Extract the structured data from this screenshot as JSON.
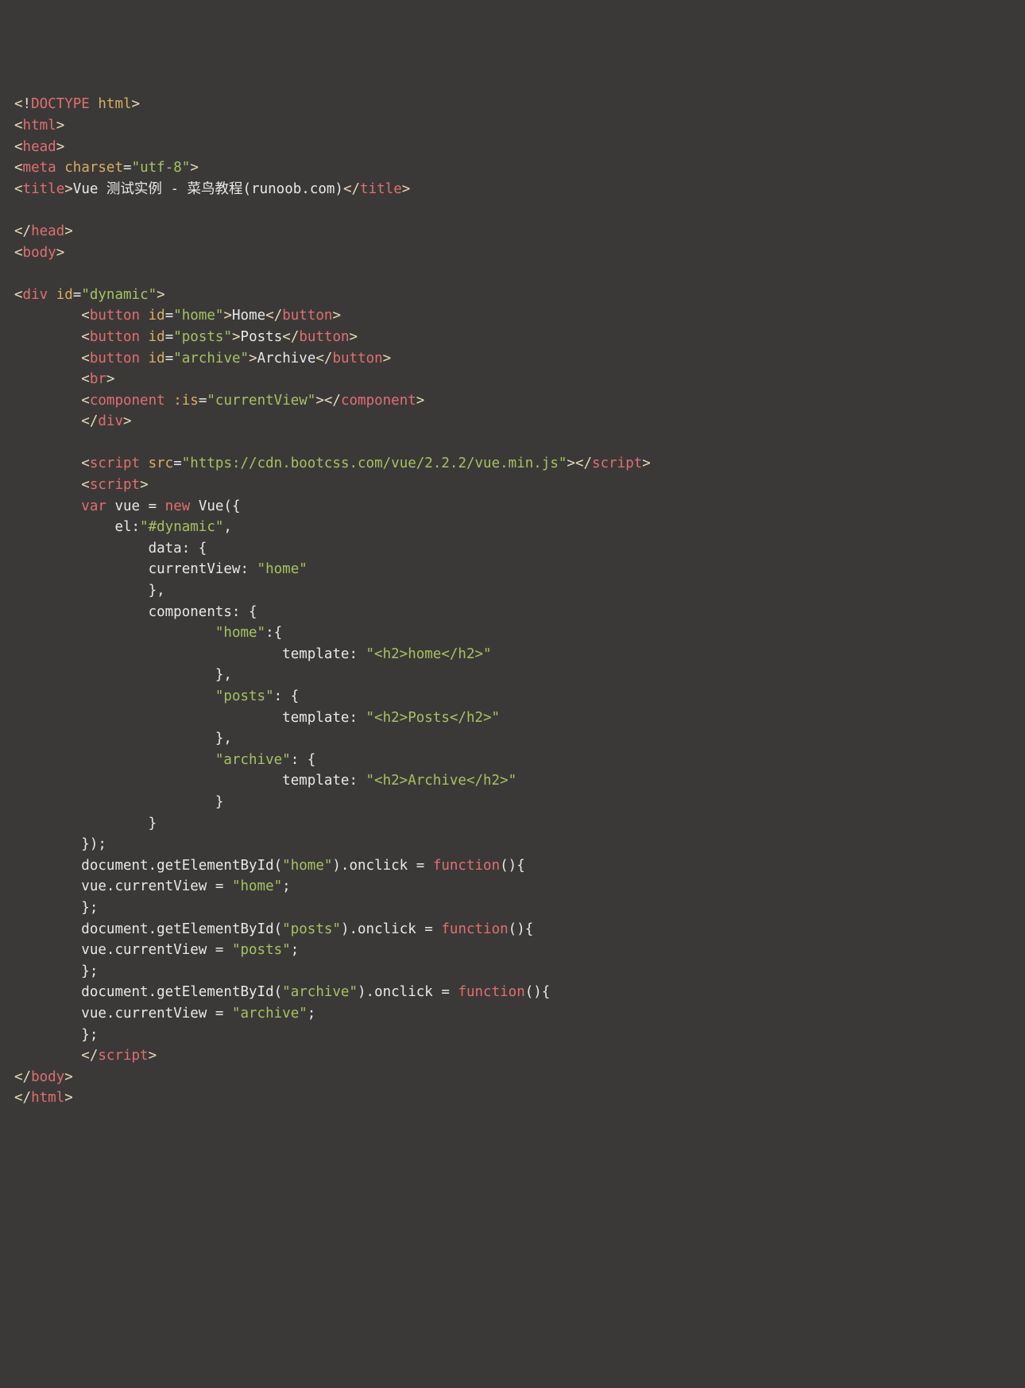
{
  "lines": [
    {
      "indent": 0,
      "parts": [
        {
          "c": "tag-bracket",
          "t": "<!"
        },
        {
          "c": "tag-name",
          "t": "DOCTYPE"
        },
        {
          "c": "text",
          "t": " "
        },
        {
          "c": "attr-name",
          "t": "html"
        },
        {
          "c": "tag-bracket",
          "t": ">"
        }
      ]
    },
    {
      "indent": 0,
      "parts": [
        {
          "c": "tag-bracket",
          "t": "<"
        },
        {
          "c": "tag-name",
          "t": "html"
        },
        {
          "c": "tag-bracket",
          "t": ">"
        }
      ]
    },
    {
      "indent": 0,
      "parts": [
        {
          "c": "tag-bracket",
          "t": "<"
        },
        {
          "c": "tag-name",
          "t": "head"
        },
        {
          "c": "tag-bracket",
          "t": ">"
        }
      ]
    },
    {
      "indent": 0,
      "parts": [
        {
          "c": "tag-bracket",
          "t": "<"
        },
        {
          "c": "tag-name",
          "t": "meta"
        },
        {
          "c": "text",
          "t": " "
        },
        {
          "c": "attr-name",
          "t": "charset"
        },
        {
          "c": "attr-eq",
          "t": "="
        },
        {
          "c": "attr-val",
          "t": "\"utf-8\""
        },
        {
          "c": "tag-bracket",
          "t": ">"
        }
      ]
    },
    {
      "indent": 0,
      "parts": [
        {
          "c": "tag-bracket",
          "t": "<"
        },
        {
          "c": "tag-name",
          "t": "title"
        },
        {
          "c": "tag-bracket",
          "t": ">"
        },
        {
          "c": "text",
          "t": "Vue 测试实例 - 菜鸟教程(runoob.com)"
        },
        {
          "c": "tag-bracket",
          "t": "</"
        },
        {
          "c": "tag-name",
          "t": "title"
        },
        {
          "c": "tag-bracket",
          "t": ">"
        }
      ]
    },
    {
      "indent": 0,
      "parts": [
        {
          "c": "text",
          "t": " "
        }
      ]
    },
    {
      "indent": 0,
      "parts": [
        {
          "c": "tag-bracket",
          "t": "</"
        },
        {
          "c": "tag-name",
          "t": "head"
        },
        {
          "c": "tag-bracket",
          "t": ">"
        }
      ]
    },
    {
      "indent": 0,
      "parts": [
        {
          "c": "tag-bracket",
          "t": "<"
        },
        {
          "c": "tag-name",
          "t": "body"
        },
        {
          "c": "tag-bracket",
          "t": ">"
        }
      ]
    },
    {
      "indent": 0,
      "parts": [
        {
          "c": "text",
          "t": " "
        }
      ]
    },
    {
      "indent": 0,
      "parts": [
        {
          "c": "tag-bracket",
          "t": "<"
        },
        {
          "c": "tag-name",
          "t": "div"
        },
        {
          "c": "text",
          "t": " "
        },
        {
          "c": "attr-name",
          "t": "id"
        },
        {
          "c": "attr-eq",
          "t": "="
        },
        {
          "c": "attr-val",
          "t": "\"dynamic\""
        },
        {
          "c": "tag-bracket",
          "t": ">"
        }
      ]
    },
    {
      "indent": 8,
      "parts": [
        {
          "c": "tag-bracket",
          "t": "<"
        },
        {
          "c": "tag-name",
          "t": "button"
        },
        {
          "c": "text",
          "t": " "
        },
        {
          "c": "attr-name",
          "t": "id"
        },
        {
          "c": "attr-eq",
          "t": "="
        },
        {
          "c": "attr-val",
          "t": "\"home\""
        },
        {
          "c": "tag-bracket",
          "t": ">"
        },
        {
          "c": "text",
          "t": "Home"
        },
        {
          "c": "tag-bracket",
          "t": "</"
        },
        {
          "c": "tag-name",
          "t": "button"
        },
        {
          "c": "tag-bracket",
          "t": ">"
        }
      ]
    },
    {
      "indent": 8,
      "parts": [
        {
          "c": "tag-bracket",
          "t": "<"
        },
        {
          "c": "tag-name",
          "t": "button"
        },
        {
          "c": "text",
          "t": " "
        },
        {
          "c": "attr-name",
          "t": "id"
        },
        {
          "c": "attr-eq",
          "t": "="
        },
        {
          "c": "attr-val",
          "t": "\"posts\""
        },
        {
          "c": "tag-bracket",
          "t": ">"
        },
        {
          "c": "text",
          "t": "Posts"
        },
        {
          "c": "tag-bracket",
          "t": "</"
        },
        {
          "c": "tag-name",
          "t": "button"
        },
        {
          "c": "tag-bracket",
          "t": ">"
        }
      ]
    },
    {
      "indent": 8,
      "parts": [
        {
          "c": "tag-bracket",
          "t": "<"
        },
        {
          "c": "tag-name",
          "t": "button"
        },
        {
          "c": "text",
          "t": " "
        },
        {
          "c": "attr-name",
          "t": "id"
        },
        {
          "c": "attr-eq",
          "t": "="
        },
        {
          "c": "attr-val",
          "t": "\"archive\""
        },
        {
          "c": "tag-bracket",
          "t": ">"
        },
        {
          "c": "text",
          "t": "Archive"
        },
        {
          "c": "tag-bracket",
          "t": "</"
        },
        {
          "c": "tag-name",
          "t": "button"
        },
        {
          "c": "tag-bracket",
          "t": ">"
        }
      ]
    },
    {
      "indent": 8,
      "parts": [
        {
          "c": "tag-bracket",
          "t": "<"
        },
        {
          "c": "tag-name",
          "t": "br"
        },
        {
          "c": "tag-bracket",
          "t": ">"
        }
      ]
    },
    {
      "indent": 8,
      "parts": [
        {
          "c": "tag-bracket",
          "t": "<"
        },
        {
          "c": "tag-name",
          "t": "component"
        },
        {
          "c": "text",
          "t": " "
        },
        {
          "c": "attr-name",
          "t": ":is"
        },
        {
          "c": "attr-eq",
          "t": "="
        },
        {
          "c": "attr-val",
          "t": "\"currentView\""
        },
        {
          "c": "tag-bracket",
          "t": ">"
        },
        {
          "c": "tag-bracket",
          "t": "</"
        },
        {
          "c": "tag-name",
          "t": "component"
        },
        {
          "c": "tag-bracket",
          "t": ">"
        }
      ]
    },
    {
      "indent": 8,
      "parts": [
        {
          "c": "tag-bracket",
          "t": "</"
        },
        {
          "c": "tag-name",
          "t": "div"
        },
        {
          "c": "tag-bracket",
          "t": ">"
        }
      ]
    },
    {
      "indent": 0,
      "parts": [
        {
          "c": "text",
          "t": " "
        }
      ]
    },
    {
      "indent": 8,
      "parts": [
        {
          "c": "tag-bracket",
          "t": "<"
        },
        {
          "c": "tag-name",
          "t": "script"
        },
        {
          "c": "text",
          "t": " "
        },
        {
          "c": "attr-name",
          "t": "src"
        },
        {
          "c": "attr-eq",
          "t": "="
        },
        {
          "c": "attr-val",
          "t": "\"https://cdn.bootcss.com/vue/2.2.2/vue.min.js\""
        },
        {
          "c": "tag-bracket",
          "t": ">"
        },
        {
          "c": "tag-bracket",
          "t": "</"
        },
        {
          "c": "tag-name",
          "t": "script"
        },
        {
          "c": "tag-bracket",
          "t": ">"
        }
      ]
    },
    {
      "indent": 8,
      "parts": [
        {
          "c": "tag-bracket",
          "t": "<"
        },
        {
          "c": "tag-name",
          "t": "script"
        },
        {
          "c": "tag-bracket",
          "t": ">"
        }
      ]
    },
    {
      "indent": 8,
      "parts": [
        {
          "c": "kw",
          "t": "var"
        },
        {
          "c": "text",
          "t": " vue = "
        },
        {
          "c": "kw",
          "t": "new"
        },
        {
          "c": "text",
          "t": " Vue({"
        }
      ]
    },
    {
      "indent": 12,
      "parts": [
        {
          "c": "text",
          "t": "el:"
        },
        {
          "c": "str",
          "t": "\"#dynamic\""
        },
        {
          "c": "text",
          "t": ","
        }
      ]
    },
    {
      "indent": 16,
      "parts": [
        {
          "c": "text",
          "t": "data: {"
        }
      ]
    },
    {
      "indent": 16,
      "parts": [
        {
          "c": "text",
          "t": "currentView: "
        },
        {
          "c": "str",
          "t": "\"home\""
        }
      ]
    },
    {
      "indent": 16,
      "parts": [
        {
          "c": "text",
          "t": "},"
        }
      ]
    },
    {
      "indent": 16,
      "parts": [
        {
          "c": "text",
          "t": "components: {"
        }
      ]
    },
    {
      "indent": 24,
      "parts": [
        {
          "c": "str",
          "t": "\"home\""
        },
        {
          "c": "text",
          "t": ":{"
        }
      ]
    },
    {
      "indent": 32,
      "parts": [
        {
          "c": "text",
          "t": "template: "
        },
        {
          "c": "str",
          "t": "\"<h2>home</h2>\""
        }
      ]
    },
    {
      "indent": 24,
      "parts": [
        {
          "c": "text",
          "t": "},"
        }
      ]
    },
    {
      "indent": 24,
      "parts": [
        {
          "c": "str",
          "t": "\"posts\""
        },
        {
          "c": "text",
          "t": ": {"
        }
      ]
    },
    {
      "indent": 32,
      "parts": [
        {
          "c": "text",
          "t": "template: "
        },
        {
          "c": "str",
          "t": "\"<h2>Posts</h2>\""
        }
      ]
    },
    {
      "indent": 24,
      "parts": [
        {
          "c": "text",
          "t": "},"
        }
      ]
    },
    {
      "indent": 24,
      "parts": [
        {
          "c": "str",
          "t": "\"archive\""
        },
        {
          "c": "text",
          "t": ": {"
        }
      ]
    },
    {
      "indent": 32,
      "parts": [
        {
          "c": "text",
          "t": "template: "
        },
        {
          "c": "str",
          "t": "\"<h2>Archive</h2>\""
        }
      ]
    },
    {
      "indent": 24,
      "parts": [
        {
          "c": "text",
          "t": "}"
        }
      ]
    },
    {
      "indent": 16,
      "parts": [
        {
          "c": "text",
          "t": "}"
        }
      ]
    },
    {
      "indent": 8,
      "parts": [
        {
          "c": "text",
          "t": "});"
        }
      ]
    },
    {
      "indent": 8,
      "parts": [
        {
          "c": "text",
          "t": "document.getElementById("
        },
        {
          "c": "str",
          "t": "\"home\""
        },
        {
          "c": "text",
          "t": ").onclick = "
        },
        {
          "c": "kw",
          "t": "function"
        },
        {
          "c": "text",
          "t": "(){"
        }
      ]
    },
    {
      "indent": 8,
      "parts": [
        {
          "c": "text",
          "t": "vue.currentView = "
        },
        {
          "c": "str",
          "t": "\"home\""
        },
        {
          "c": "text",
          "t": ";"
        }
      ]
    },
    {
      "indent": 8,
      "parts": [
        {
          "c": "text",
          "t": "};"
        }
      ]
    },
    {
      "indent": 8,
      "parts": [
        {
          "c": "text",
          "t": "document.getElementById("
        },
        {
          "c": "str",
          "t": "\"posts\""
        },
        {
          "c": "text",
          "t": ").onclick = "
        },
        {
          "c": "kw",
          "t": "function"
        },
        {
          "c": "text",
          "t": "(){"
        }
      ]
    },
    {
      "indent": 8,
      "parts": [
        {
          "c": "text",
          "t": "vue.currentView = "
        },
        {
          "c": "str",
          "t": "\"posts\""
        },
        {
          "c": "text",
          "t": ";"
        }
      ]
    },
    {
      "indent": 8,
      "parts": [
        {
          "c": "text",
          "t": "};"
        }
      ]
    },
    {
      "indent": 8,
      "parts": [
        {
          "c": "text",
          "t": "document.getElementById("
        },
        {
          "c": "str",
          "t": "\"archive\""
        },
        {
          "c": "text",
          "t": ").onclick = "
        },
        {
          "c": "kw",
          "t": "function"
        },
        {
          "c": "text",
          "t": "(){"
        }
      ]
    },
    {
      "indent": 8,
      "parts": [
        {
          "c": "text",
          "t": "vue.currentView = "
        },
        {
          "c": "str",
          "t": "\"archive\""
        },
        {
          "c": "text",
          "t": ";"
        }
      ]
    },
    {
      "indent": 8,
      "parts": [
        {
          "c": "text",
          "t": "};"
        }
      ]
    },
    {
      "indent": 8,
      "parts": [
        {
          "c": "tag-bracket",
          "t": "</"
        },
        {
          "c": "tag-name",
          "t": "script"
        },
        {
          "c": "tag-bracket",
          "t": ">"
        }
      ]
    },
    {
      "indent": 0,
      "parts": [
        {
          "c": "tag-bracket",
          "t": "</"
        },
        {
          "c": "tag-name",
          "t": "body"
        },
        {
          "c": "tag-bracket",
          "t": ">"
        }
      ]
    },
    {
      "indent": 0,
      "parts": [
        {
          "c": "tag-bracket",
          "t": "</"
        },
        {
          "c": "tag-name",
          "t": "html"
        },
        {
          "c": "tag-bracket",
          "t": ">"
        }
      ]
    }
  ]
}
